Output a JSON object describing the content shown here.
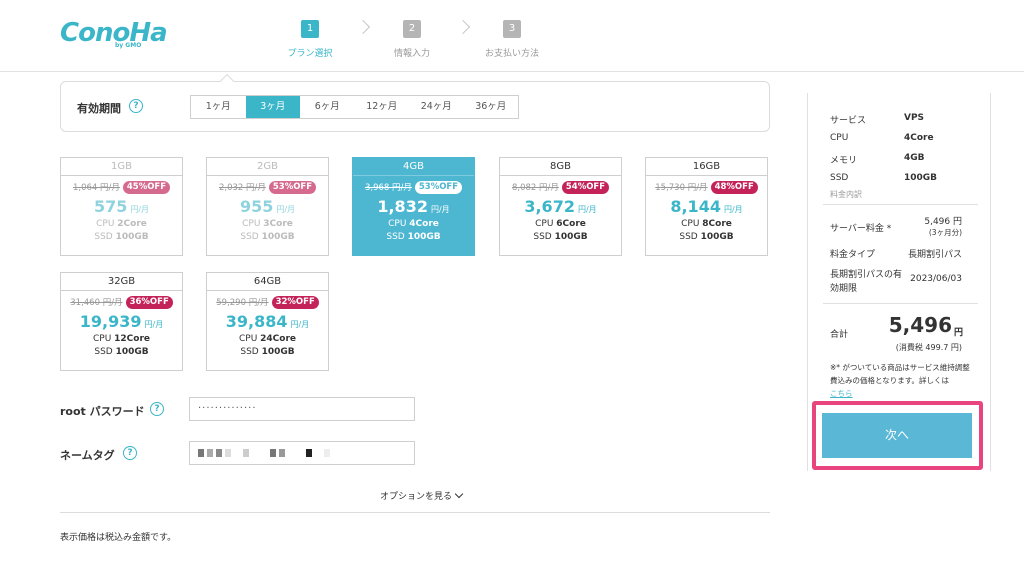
{
  "header": {
    "logo_text": "ConoHa",
    "logo_sub": "by GMO",
    "steps": [
      {
        "num": "1",
        "label": "プラン選択"
      },
      {
        "num": "2",
        "label": "情報入力"
      },
      {
        "num": "3",
        "label": "お支払い方法"
      }
    ]
  },
  "period": {
    "label": "有効期間",
    "tabs": [
      "1ヶ月",
      "3ヶ月",
      "6ヶ月",
      "12ヶ月",
      "24ヶ月",
      "36ヶ月"
    ],
    "selected": "3ヶ月"
  },
  "plans": [
    {
      "mem": "1GB",
      "orig": "1,064 円/月",
      "off": "45%OFF",
      "price": "575",
      "unit": "円/月",
      "cpu_pre": "CPU ",
      "cpu": "2Core",
      "ssd_pre": "SSD ",
      "ssd": "100GB",
      "state": "disabled"
    },
    {
      "mem": "2GB",
      "orig": "2,032 円/月",
      "off": "53%OFF",
      "price": "955",
      "unit": "円/月",
      "cpu_pre": "CPU ",
      "cpu": "3Core",
      "ssd_pre": "SSD ",
      "ssd": "100GB",
      "state": "disabled"
    },
    {
      "mem": "4GB",
      "orig": "3,968 円/月",
      "off": "53%OFF",
      "price": "1,832",
      "unit": "円/月",
      "cpu_pre": "CPU ",
      "cpu": "4Core",
      "ssd_pre": "SSD ",
      "ssd": "100GB",
      "state": "selected"
    },
    {
      "mem": "8GB",
      "orig": "8,082 円/月",
      "off": "54%OFF",
      "price": "3,672",
      "unit": "円/月",
      "cpu_pre": "CPU ",
      "cpu": "6Core",
      "ssd_pre": "SSD ",
      "ssd": "100GB",
      "state": "normal"
    },
    {
      "mem": "16GB",
      "orig": "15,730 円/月",
      "off": "48%OFF",
      "price": "8,144",
      "unit": "円/月",
      "cpu_pre": "CPU ",
      "cpu": "8Core",
      "ssd_pre": "SSD ",
      "ssd": "100GB",
      "state": "normal"
    },
    {
      "mem": "32GB",
      "orig": "31,460 円/月",
      "off": "36%OFF",
      "price": "19,939",
      "unit": "円/月",
      "cpu_pre": "CPU ",
      "cpu": "12Core",
      "ssd_pre": "SSD ",
      "ssd": "100GB",
      "state": "normal"
    },
    {
      "mem": "64GB",
      "orig": "59,290 円/月",
      "off": "32%OFF",
      "price": "39,884",
      "unit": "円/月",
      "cpu_pre": "CPU ",
      "cpu": "24Core",
      "ssd_pre": "SSD ",
      "ssd": "100GB",
      "state": "normal"
    }
  ],
  "form": {
    "root_password_label": "root パスワード",
    "root_password_value": "··············",
    "name_tag_label": "ネームタグ",
    "help_glyph": "?"
  },
  "options_link": "オプションを見る",
  "tax_note": "表示価格は税込み金額です。",
  "summary": {
    "service_label": "サービス",
    "service_value": "VPS",
    "cpu_label": "CPU",
    "cpu_value": "4Core",
    "memory_label": "メモリ",
    "memory_value": "4GB",
    "ssd_label": "SSD",
    "ssd_value": "100GB",
    "breakdown_label": "料金内訳",
    "server_fee_label": "サーバー料金 *",
    "server_fee_value": "5,496 円",
    "server_fee_period": "(3ヶ月分)",
    "fee_type_label": "料金タイプ",
    "fee_type_value": "長期割引パス",
    "pass_expiry_label_1": "長期割引パスの有",
    "pass_expiry_label_2": "効期限",
    "pass_expiry_value": "2023/06/03",
    "total_label": "合計",
    "total_value": "5,496",
    "total_unit": "円",
    "total_tax": "(消費税 499.7 円)",
    "note_text": "※* がついている商品はサービス維持調整費込みの価格となります。詳しくは",
    "note_link": "こちら"
  },
  "next_button": "次へ",
  "colors": {
    "accent": "#3bb6c9",
    "selected_card": "#4db6d0",
    "discount": "#c4235a",
    "highlight": "#e8457f"
  }
}
